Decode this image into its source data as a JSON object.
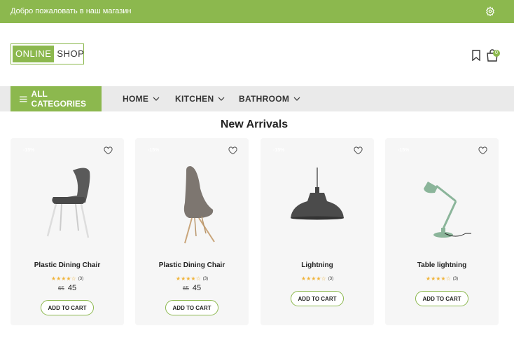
{
  "topbar": {
    "welcome": "Добро пожаловать в наш магазин",
    "settings_icon": "gear-icon"
  },
  "header": {
    "logo": {
      "part_a": "ONLINE",
      "part_b": "SHOP"
    },
    "bookmark_icon": "bookmark-icon",
    "cart_icon": "shopping-bag-icon",
    "cart_count": "0"
  },
  "nav": {
    "categories_label": "ALL CATEGORIES",
    "items": [
      {
        "label": "HOME"
      },
      {
        "label": "KITCHEN"
      },
      {
        "label": "BATHROOM"
      }
    ]
  },
  "section": {
    "title": "New Arrivals"
  },
  "products": [
    {
      "sale": "-15%",
      "name": "Plastic Dining Chair",
      "stars": "★★★★☆",
      "rating_count": "(3)",
      "old_price": "65",
      "price": "45",
      "button": "ADD TO CART",
      "image": "dark-chair"
    },
    {
      "sale": "-15%",
      "name": "Plastic Dining Chair",
      "stars": "★★★★☆",
      "rating_count": "(3)",
      "old_price": "65",
      "price": "45",
      "button": "ADD TO CART",
      "image": "egg-chair"
    },
    {
      "sale": "-15%",
      "name": "Lightning",
      "stars": "★★★★☆",
      "rating_count": "(3)",
      "old_price": "",
      "price": "",
      "button": "ADD TO CART",
      "image": "pendant-lamp"
    },
    {
      "sale": "-15%",
      "name": "Table lightning",
      "stars": "★★★★☆",
      "rating_count": "(3)",
      "old_price": "",
      "price": "",
      "button": "ADD TO CART",
      "image": "desk-lamp"
    }
  ],
  "colors": {
    "accent": "#8cb84e",
    "nav_bg": "#eaeaea",
    "card_bg": "#f6f6f6",
    "star": "#f0b43c"
  }
}
